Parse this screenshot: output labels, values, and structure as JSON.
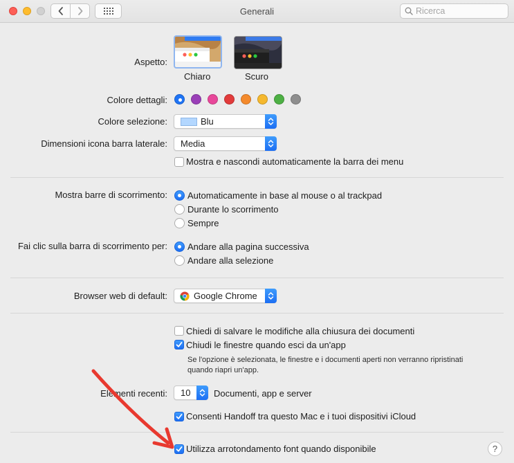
{
  "window": {
    "title": "Generali",
    "search_placeholder": "Ricerca"
  },
  "appearance": {
    "label": "Aspetto:",
    "options": [
      {
        "name": "Chiaro",
        "selected": true
      },
      {
        "name": "Scuro",
        "selected": false
      }
    ]
  },
  "accent": {
    "label": "Colore dettagli:",
    "colors": [
      "#1f74f5",
      "#9a3fb8",
      "#e8479a",
      "#e23b3b",
      "#f48a2c",
      "#f5b82e",
      "#4db044",
      "#8e8e8e"
    ],
    "selected_index": 0
  },
  "highlight": {
    "label": "Colore selezione:",
    "value": "Blu",
    "swatch_color": "#b3d7ff"
  },
  "sidebar_icon_size": {
    "label": "Dimensioni icona barra laterale:",
    "value": "Media"
  },
  "menubar_autohide": {
    "label": "Mostra e nascondi automaticamente la barra dei menu",
    "checked": false
  },
  "show_scrollbars": {
    "label": "Mostra barre di scorrimento:",
    "options": [
      {
        "label": "Automaticamente in base al mouse o al trackpad",
        "selected": true
      },
      {
        "label": "Durante lo scorrimento",
        "selected": false
      },
      {
        "label": "Sempre",
        "selected": false
      }
    ]
  },
  "click_scrollbar": {
    "label": "Fai clic sulla barra di scorrimento per:",
    "options": [
      {
        "label": "Andare alla pagina successiva",
        "selected": true
      },
      {
        "label": "Andare alla selezione",
        "selected": false
      }
    ]
  },
  "default_browser": {
    "label": "Browser web di default:",
    "value": "Google Chrome"
  },
  "documents": {
    "ask_save": {
      "label": "Chiedi di salvare le modifiche alla chiusura dei documenti",
      "checked": false
    },
    "close_windows": {
      "label": "Chiudi le finestre quando esci da un'app",
      "checked": true
    },
    "note_line1": "Se l'opzione è selezionata, le finestre e i documenti aperti non verranno ripristinati",
    "note_line2": "quando riapri un'app."
  },
  "recent_items": {
    "label": "Elementi recenti:",
    "value": "10",
    "suffix": "Documenti, app e server"
  },
  "handoff": {
    "label": "Consenti Handoff tra questo Mac e i tuoi dispositivi iCloud",
    "checked": true
  },
  "font_smoothing": {
    "label": "Utilizza arrotondamento font quando disponibile",
    "checked": true
  },
  "help_label": "?",
  "annotation": {
    "color": "#e8392f"
  }
}
